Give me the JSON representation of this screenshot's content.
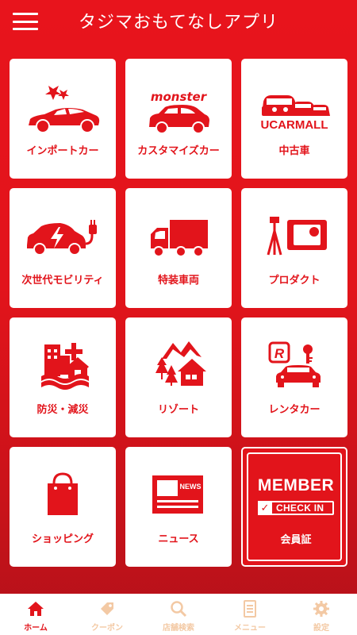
{
  "app": {
    "title": "タジマおもてなしアプリ"
  },
  "tiles": [
    {
      "label": "インポートカー",
      "icon": "import-car-icon"
    },
    {
      "label": "カスタマイズカー",
      "icon": "monster-custom-car-icon",
      "logo_text": "monster"
    },
    {
      "label": "中古車",
      "icon": "ucar-mall-icon",
      "logo_text": "UCARMALL"
    },
    {
      "label": "次世代モビリティ",
      "icon": "electric-car-icon"
    },
    {
      "label": "特装車両",
      "icon": "truck-icon"
    },
    {
      "label": "プロダクト",
      "icon": "camera-tripod-icon"
    },
    {
      "label": "防災・減災",
      "icon": "disaster-prevention-icon"
    },
    {
      "label": "リゾート",
      "icon": "resort-cabin-icon"
    },
    {
      "label": "レンタカー",
      "icon": "rental-car-icon"
    },
    {
      "label": "ショッピング",
      "icon": "shopping-bag-icon"
    },
    {
      "label": "ニュース",
      "icon": "newspaper-icon",
      "badge_text": "NEWS"
    }
  ],
  "member": {
    "title": "MEMBER",
    "checkin": "CHECK IN",
    "label": "会員証"
  },
  "tabs": [
    {
      "label": "ホーム",
      "icon": "home-icon",
      "active": true
    },
    {
      "label": "クーポン",
      "icon": "coupon-icon",
      "active": false
    },
    {
      "label": "店舗検索",
      "icon": "search-icon",
      "active": false
    },
    {
      "label": "メニュー",
      "icon": "menu-list-icon",
      "active": false
    },
    {
      "label": "設定",
      "icon": "gear-icon",
      "active": false
    }
  ],
  "colors": {
    "brand_red": "#e2141b",
    "tab_inactive": "#f3c9a4",
    "white": "#ffffff"
  }
}
